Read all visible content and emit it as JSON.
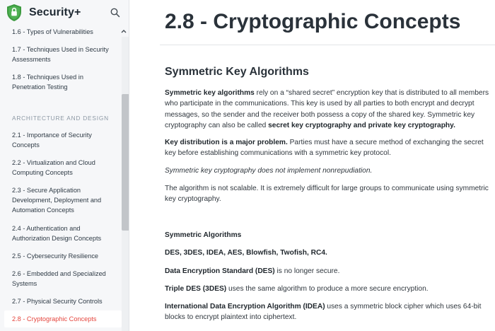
{
  "app": {
    "title": "Security+"
  },
  "sidebar": {
    "items_top": [
      {
        "label": "1.6 - Types of Vulnerabilities"
      },
      {
        "label": "1.7 - Techniques Used in Security Assessments"
      },
      {
        "label": "1.8 - Techniques Used in Penetration Testing"
      }
    ],
    "section_heading": "ARCHITECTURE AND DESIGN",
    "items": [
      {
        "label": "2.1 - Importance of Security Concepts"
      },
      {
        "label": "2.2 - Virtualization and Cloud Computing Concepts"
      },
      {
        "label": "2.3 - Secure Application Development, Deployment and Automation Concepts"
      },
      {
        "label": "2.4 - Authentication and Authorization Design Concepts"
      },
      {
        "label": "2.5 - Cybersecurity Resilience"
      },
      {
        "label": "2.6 - Embedded and Specialized Systems"
      },
      {
        "label": "2.7 - Physical Security Controls"
      },
      {
        "label": "2.8 - Cryptographic Concepts"
      }
    ],
    "active_color": "#e5463e"
  },
  "main": {
    "title": "2.8 - Cryptographic Concepts",
    "section_title": "Symmetric Key Algorithms",
    "p1": {
      "lead": "Symmetric key algorithms",
      "text": " rely on a “shared secret” encryption key that is distributed to all members who participate in the communications. This key is used by all parties to both encrypt and decrypt messages, so the sender and the receiver both possess a copy of the shared key. Symmetric key cryptography can also be called ",
      "bold_end": "secret key cryptography and private key cryptography."
    },
    "p2": {
      "lead": "Key distribution is a major problem.",
      "text": " Parties must have a secure method of exchanging the secret key before establishing communications with a symmetric key protocol."
    },
    "p3": "Symmetric key cryptography does not implement nonrepudiation.",
    "p4": "The algorithm is not scalable. It is extremely difficult for large groups to communicate using symmetric key cryptography.",
    "algorithms_heading": "Symmetric Algorithms",
    "algorithms_list": "DES, 3DES, IDEA, AES, Blowfish, Twofish, RC4.",
    "p5": {
      "lead": "Data Encryption Standard (DES)",
      "text": " is no longer secure."
    },
    "p6": {
      "lead": "Triple DES (3DES)",
      "text": " uses the same algorithm to produce a more secure encryption."
    },
    "p7": {
      "lead": "International Data Encryption Algorithm (IDEA)",
      "text": " uses a symmetric block cipher which uses 64-bit blocks to encrypt plaintext into ciphertext."
    }
  },
  "icons": {
    "logo": "shield-icon",
    "search": "search-icon",
    "collapse": "chevron-up-icon"
  },
  "colors": {
    "logo_green": "#3c9a3f",
    "sidebar_bg": "#f6f7f9"
  }
}
